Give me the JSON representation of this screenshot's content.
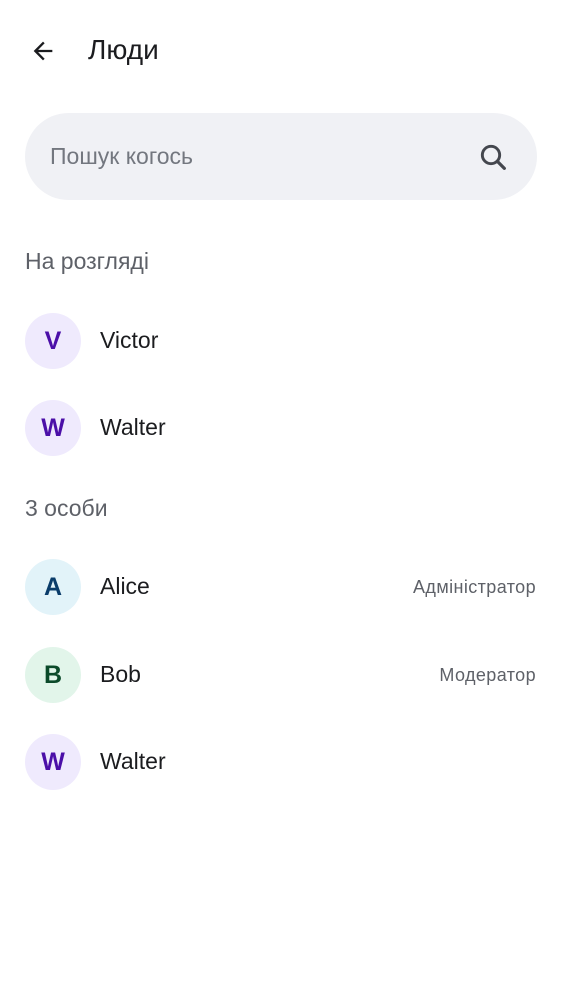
{
  "header": {
    "title": "Люди"
  },
  "search": {
    "placeholder": "Пошук когось",
    "value": ""
  },
  "pending": {
    "heading": "На розгляді",
    "items": [
      {
        "initial": "V",
        "name": "Victor",
        "avatar_bg": "#efeafd",
        "avatar_fg": "#4b0fa8"
      },
      {
        "initial": "W",
        "name": "Walter",
        "avatar_bg": "#efeafd",
        "avatar_fg": "#4b0fa8"
      }
    ]
  },
  "members": {
    "heading": "3 особи",
    "items": [
      {
        "initial": "A",
        "name": "Alice",
        "role": "Адміністратор",
        "avatar_bg": "#e2f3f9",
        "avatar_fg": "#0a3c6a"
      },
      {
        "initial": "B",
        "name": "Bob",
        "role": "Модератор",
        "avatar_bg": "#e2f5ea",
        "avatar_fg": "#0b4a2a"
      },
      {
        "initial": "W",
        "name": "Walter",
        "role": "",
        "avatar_bg": "#efeafd",
        "avatar_fg": "#4b0fa8"
      }
    ]
  }
}
